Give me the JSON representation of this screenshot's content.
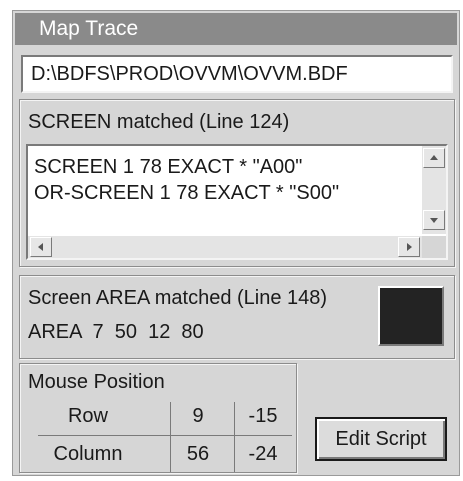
{
  "window": {
    "title": "Map Trace"
  },
  "file_path": "D:\\BDFS\\PROD\\OVVM\\OVVM.BDF",
  "screen_match": {
    "header": "SCREEN matched (Line 124)",
    "lines": [
      "SCREEN 1 78 EXACT * \"A00\"",
      "OR-SCREEN 1 78 EXACT * \"S00\""
    ]
  },
  "area_match": {
    "header": "Screen AREA matched (Line 148)",
    "values": "AREA  7  50  12  80",
    "color": "#232323"
  },
  "mouse_position": {
    "title": "Mouse Position",
    "rows": [
      {
        "label": "Row",
        "a": "9",
        "b": "-15"
      },
      {
        "label": "Column",
        "a": "56",
        "b": "-24"
      }
    ]
  },
  "edit_button": {
    "label": "Edit Script"
  },
  "icons": {
    "scroll_up": "triangle-up",
    "scroll_down": "triangle-down",
    "scroll_left": "triangle-left",
    "scroll_right": "triangle-right"
  }
}
